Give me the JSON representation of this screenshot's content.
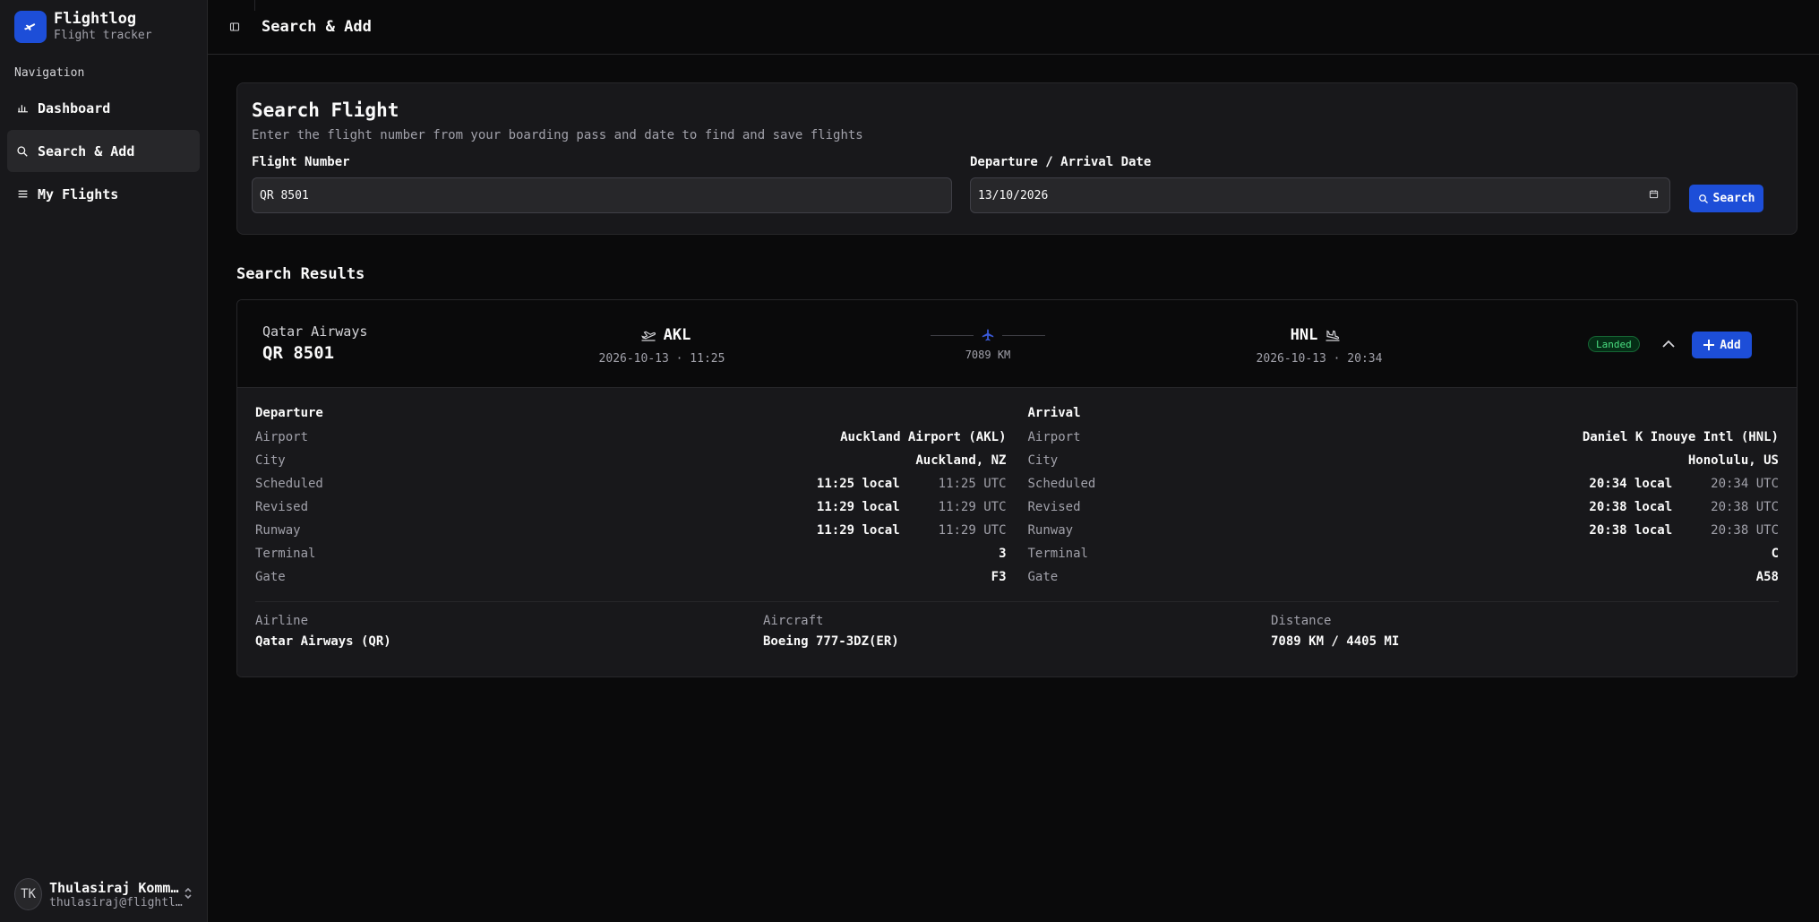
{
  "brand": {
    "name": "Flightlog",
    "subtitle": "Flight tracker"
  },
  "nav": {
    "heading": "Navigation",
    "items": [
      {
        "label": "Dashboard",
        "icon": "bar-chart-icon"
      },
      {
        "label": "Search & Add",
        "icon": "search-icon",
        "active": true
      },
      {
        "label": "My Flights",
        "icon": "list-icon"
      }
    ]
  },
  "user": {
    "initials": "TK",
    "name": "Thulasiraj Komminar",
    "email": "thulasiraj@flightlog.app"
  },
  "header": {
    "title": "Search & Add"
  },
  "search": {
    "title": "Search Flight",
    "description": "Enter the flight number from your boarding pass and date to find and save flights",
    "flight_label": "Flight Number",
    "flight_value": "QR 8501",
    "date_label": "Departure / Arrival Date",
    "date_value": "13/10/2026",
    "button": "Search"
  },
  "results": {
    "title": "Search Results",
    "flight": {
      "airline": "Qatar Airways",
      "number": "QR 8501",
      "dep_code": "AKL",
      "dep_time": "2026-10-13 · 11:25",
      "arr_code": "HNL",
      "arr_time": "2026-10-13 · 20:34",
      "distance": "7089 KM",
      "status": "Landed",
      "add_label": "Add"
    },
    "departure": {
      "title": "Departure",
      "airport_k": "Airport",
      "airport": "Auckland Airport (AKL)",
      "city_k": "City",
      "city": "Auckland, NZ",
      "scheduled_k": "Scheduled",
      "scheduled_local": "11:25 local",
      "scheduled_utc": "11:25 UTC",
      "revised_k": "Revised",
      "revised_local": "11:29 local",
      "revised_utc": "11:29 UTC",
      "runway_k": "Runway",
      "runway_local": "11:29 local",
      "runway_utc": "11:29 UTC",
      "terminal_k": "Terminal",
      "terminal": "3",
      "gate_k": "Gate",
      "gate": "F3"
    },
    "arrival": {
      "title": "Arrival",
      "airport_k": "Airport",
      "airport": "Daniel K Inouye Intl (HNL)",
      "city_k": "City",
      "city": "Honolulu, US",
      "scheduled_k": "Scheduled",
      "scheduled_local": "20:34 local",
      "scheduled_utc": "20:34 UTC",
      "revised_k": "Revised",
      "revised_local": "20:38 local",
      "revised_utc": "20:38 UTC",
      "runway_k": "Runway",
      "runway_local": "20:38 local",
      "runway_utc": "20:38 UTC",
      "terminal_k": "Terminal",
      "terminal": "C",
      "gate_k": "Gate",
      "gate": "A58"
    },
    "meta": {
      "airline_k": "Airline",
      "airline": "Qatar Airways (QR)",
      "aircraft_k": "Aircraft",
      "aircraft": "Boeing 777-3DZ(ER)",
      "distance_k": "Distance",
      "distance": "7089 KM / 4405 MI"
    }
  },
  "colors": {
    "accent": "#1d4ed8",
    "status_green": "#4ade80",
    "background": "#0a0a0b",
    "panel": "#18181b"
  }
}
